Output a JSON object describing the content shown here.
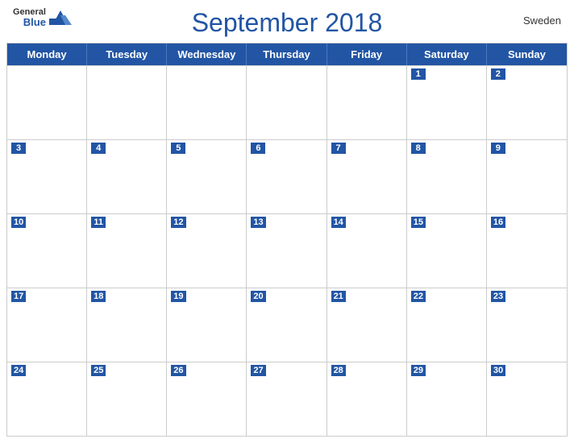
{
  "header": {
    "logo": {
      "general": "General",
      "blue": "Blue"
    },
    "title": "September 2018",
    "country": "Sweden"
  },
  "days_of_week": [
    "Monday",
    "Tuesday",
    "Wednesday",
    "Thursday",
    "Friday",
    "Saturday",
    "Sunday"
  ],
  "weeks": [
    [
      {
        "num": "",
        "empty": true
      },
      {
        "num": "",
        "empty": true
      },
      {
        "num": "",
        "empty": true
      },
      {
        "num": "",
        "empty": true
      },
      {
        "num": "",
        "empty": true
      },
      {
        "num": "1",
        "empty": false
      },
      {
        "num": "2",
        "empty": false
      }
    ],
    [
      {
        "num": "3",
        "empty": false
      },
      {
        "num": "4",
        "empty": false
      },
      {
        "num": "5",
        "empty": false
      },
      {
        "num": "6",
        "empty": false
      },
      {
        "num": "7",
        "empty": false
      },
      {
        "num": "8",
        "empty": false
      },
      {
        "num": "9",
        "empty": false
      }
    ],
    [
      {
        "num": "10",
        "empty": false
      },
      {
        "num": "11",
        "empty": false
      },
      {
        "num": "12",
        "empty": false
      },
      {
        "num": "13",
        "empty": false
      },
      {
        "num": "14",
        "empty": false
      },
      {
        "num": "15",
        "empty": false
      },
      {
        "num": "16",
        "empty": false
      }
    ],
    [
      {
        "num": "17",
        "empty": false
      },
      {
        "num": "18",
        "empty": false
      },
      {
        "num": "19",
        "empty": false
      },
      {
        "num": "20",
        "empty": false
      },
      {
        "num": "21",
        "empty": false
      },
      {
        "num": "22",
        "empty": false
      },
      {
        "num": "23",
        "empty": false
      }
    ],
    [
      {
        "num": "24",
        "empty": false
      },
      {
        "num": "25",
        "empty": false
      },
      {
        "num": "26",
        "empty": false
      },
      {
        "num": "27",
        "empty": false
      },
      {
        "num": "28",
        "empty": false
      },
      {
        "num": "29",
        "empty": false
      },
      {
        "num": "30",
        "empty": false
      }
    ]
  ]
}
